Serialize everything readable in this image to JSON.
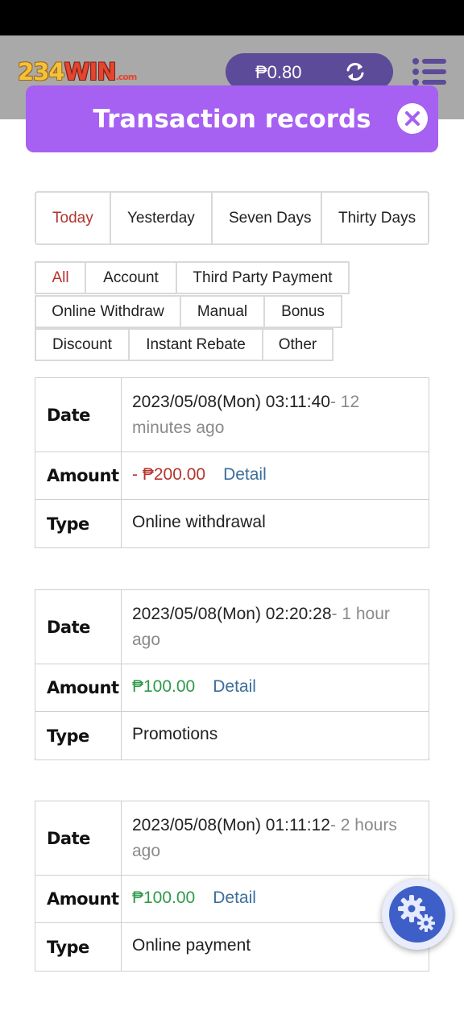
{
  "header": {
    "logo_main": "234",
    "logo_win": "WIN",
    "logo_suffix": ".com",
    "balance": "₱0.80"
  },
  "modal": {
    "title": "Transaction records"
  },
  "date_tabs": [
    {
      "label": "Today",
      "active": true
    },
    {
      "label": "Yesterday",
      "active": false
    },
    {
      "label": "Seven Days",
      "active": false
    },
    {
      "label": "Thirty Days",
      "active": false
    }
  ],
  "filters": [
    {
      "label": "All",
      "active": true
    },
    {
      "label": "Account",
      "active": false
    },
    {
      "label": "Third Party Payment",
      "active": false
    },
    {
      "label": "Online Withdraw",
      "active": false
    },
    {
      "label": "Manual",
      "active": false
    },
    {
      "label": "Bonus",
      "active": false
    },
    {
      "label": "Discount",
      "active": false
    },
    {
      "label": "Instant Rebate",
      "active": false
    },
    {
      "label": "Other",
      "active": false
    }
  ],
  "labels": {
    "date": "Date",
    "amount": "Amount",
    "type": "Type",
    "detail": "Detail"
  },
  "records": [
    {
      "datetime": "2023/05/08(Mon) 03:11:40",
      "ago": "- 12 minutes ago",
      "amount": "- ₱200.00",
      "type": "Online withdrawal"
    },
    {
      "datetime": "2023/05/08(Mon) 02:20:28",
      "ago": "- 1 hour ago",
      "amount": "₱100.00",
      "type": "Promotions"
    },
    {
      "datetime": "2023/05/08(Mon) 01:11:12",
      "ago": "- 2 hours ago",
      "amount": "₱100.00",
      "type": "Online payment"
    }
  ],
  "colors": {
    "modal_header": "#a660f2",
    "balance_pill": "#5c4b98",
    "negative": "#b4342e",
    "positive": "#2f9a4a",
    "link": "#3c6e9a"
  },
  "icons": [
    "refresh-icon",
    "menu-icon",
    "close-icon",
    "settings-gear-icon"
  ]
}
